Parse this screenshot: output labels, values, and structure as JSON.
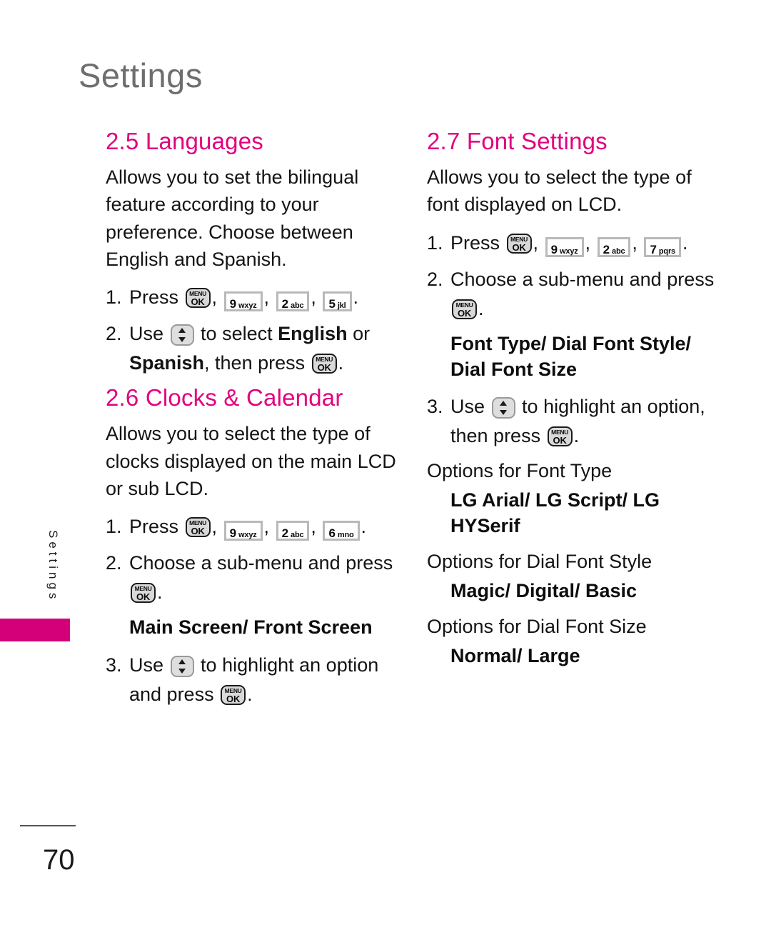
{
  "page": {
    "running_head": "Settings",
    "side_tab_label": "Settings",
    "page_number": "70",
    "accent_pink": "#e2007f",
    "tab_pink": "#d4007a",
    "header_gray": "#6e6e6e"
  },
  "keys": {
    "menu_ok": {
      "top": "MENU",
      "bottom": "OK",
      "name": "menu-ok-key"
    },
    "k2": {
      "digit": "2",
      "letters": "abc"
    },
    "k5": {
      "digit": "5",
      "letters": "jkl"
    },
    "k6": {
      "digit": "6",
      "letters": "mno"
    },
    "k7": {
      "digit": "7",
      "letters": "pqrs"
    },
    "k9": {
      "digit": "9",
      "letters": "wxyz"
    },
    "nav": {
      "name": "navigation-up-down-key"
    }
  },
  "left_column": {
    "languages": {
      "title": "2.5 Languages",
      "description": "Allows you to set the bilingual feature according to your preference. Choose between English and Spanish.",
      "step1": {
        "number": "1.",
        "lead": "Press",
        "trail": "."
      },
      "step2": {
        "number": "2.",
        "lead": "Use",
        "mid": "to select",
        "bold1": "English",
        "conj": "or",
        "bold2": "Spanish",
        "tail": ", then press",
        "trail": "."
      }
    },
    "clocks": {
      "title": "2.6 Clocks & Calendar",
      "description": "Allows you to select the type of clocks displayed on the main LCD or sub LCD.",
      "step1": {
        "number": "1.",
        "lead": "Press",
        "trail": "."
      },
      "step2": {
        "number": "2.",
        "text": "Choose a sub-menu and press",
        "trail": "."
      },
      "submenu_options": "Main Screen/ Front Screen",
      "step3": {
        "number": "3.",
        "lead": "Use",
        "mid": "to highlight an option and press",
        "trail": "."
      }
    }
  },
  "right_column": {
    "font_settings": {
      "title": "2.7 Font Settings",
      "description": "Allows you to select the type of font displayed on LCD.",
      "step1": {
        "number": "1.",
        "lead": "Press",
        "trail": "."
      },
      "step2": {
        "number": "2.",
        "text": "Choose a sub-menu and press",
        "trail": "."
      },
      "submenu_options": "Font Type/ Dial Font Style/ Dial Font Size",
      "step3": {
        "number": "3.",
        "lead": "Use",
        "mid": "to highlight an option, then press",
        "trail": "."
      },
      "options_font_type_label": "Options for Font Type",
      "options_font_type_values": "LG Arial/ LG Script/ LG HYSerif",
      "options_dial_font_style_label": "Options for Dial Font Style",
      "options_dial_font_style_values": "Magic/ Digital/ Basic",
      "options_dial_font_size_label": "Options for Dial Font Size",
      "options_dial_font_size_values": "Normal/ Large"
    }
  }
}
